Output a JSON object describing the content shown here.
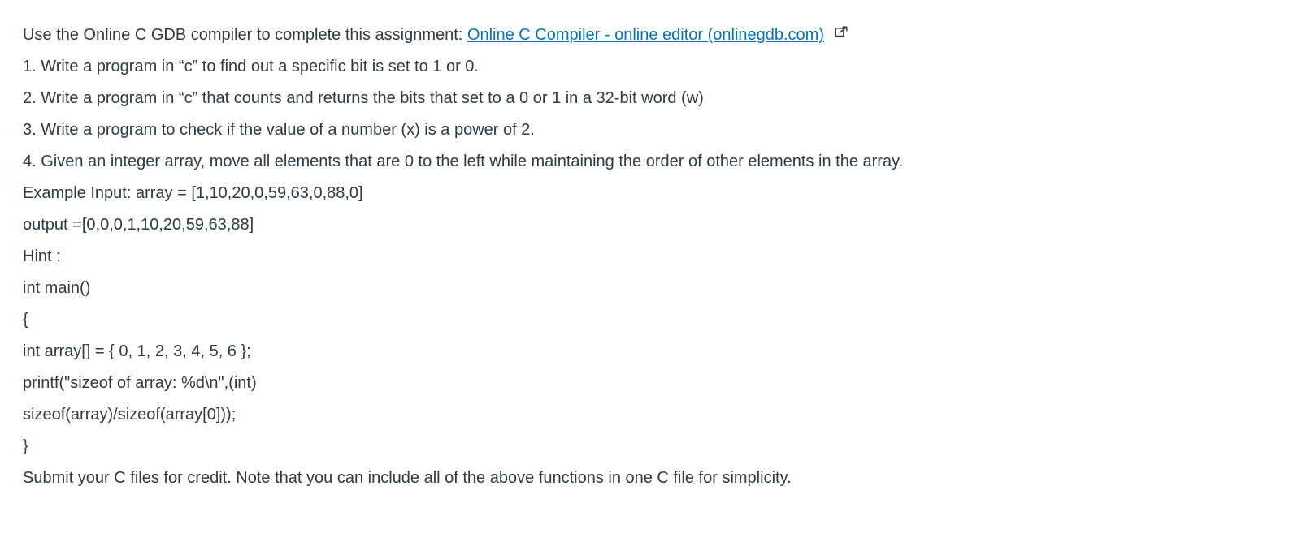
{
  "intro": {
    "text": "Use the Online C GDB compiler to complete this assignment: ",
    "link_text": "Online C Compiler - online editor (onlinegdb.com)"
  },
  "items": {
    "q1": "1. Write a program in “c” to find out a specific bit is set to 1 or 0.",
    "q2": "2. Write a program in “c” that counts and returns the bits that set to a 0 or 1 in a 32-bit word (w)",
    "q3": "3. Write a program to check if the value of a number (x) is a power of 2.",
    "q4": "4. Given an integer array, move all elements that are 0 to the left while maintaining the order of other elements in the array."
  },
  "example": {
    "input": "Example Input: array = [1,10,20,0,59,63,0,88,0]",
    "output": "output =[0,0,0,1,10,20,59,63,88]"
  },
  "hint": {
    "label": "Hint :",
    "c1": "int main()",
    "c2": "{",
    "c3": "int array[] = { 0, 1, 2, 3, 4, 5, 6 };",
    "c4": "printf(\"sizeof of array: %d\\n\",(int)",
    "c5": "sizeof(array)/sizeof(array[0]));",
    "c6": "}"
  },
  "footer": "Submit your C files for credit. Note that you can include all of the above functions in one C file for simplicity."
}
